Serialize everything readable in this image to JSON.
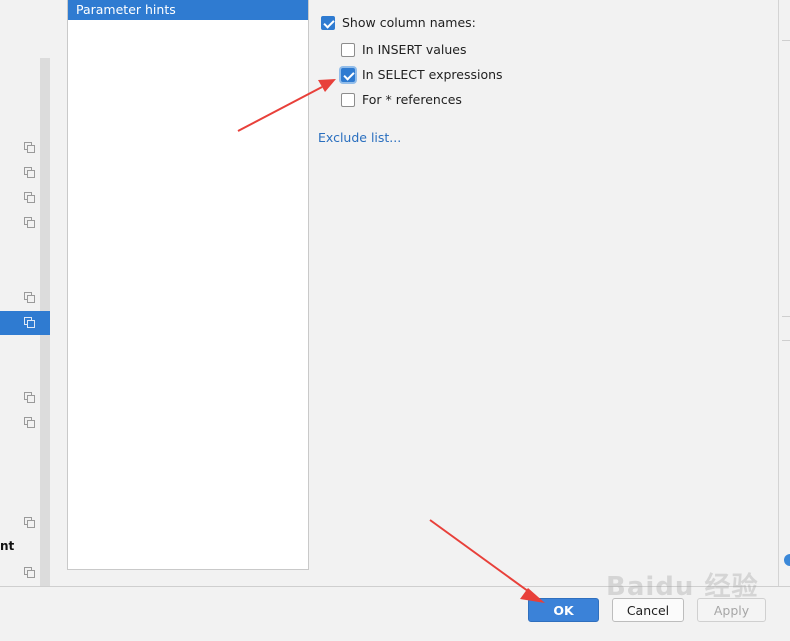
{
  "list": {
    "selected_item": "Parameter hints"
  },
  "options": {
    "show_column_names": {
      "label": "Show column names:",
      "checked": true
    },
    "items": [
      {
        "label": "In INSERT values",
        "checked": false
      },
      {
        "label": "In SELECT expressions",
        "checked": true
      },
      {
        "label": "For * references",
        "checked": false
      }
    ],
    "exclude_link": "Exclude list..."
  },
  "left_tree": {
    "partial_text": "nt"
  },
  "buttons": {
    "ok": "OK",
    "cancel": "Cancel",
    "apply": "Apply"
  },
  "colors": {
    "accent": "#2f7bd1",
    "annotation": "#e8403a"
  },
  "watermark": "Baidu 经验"
}
